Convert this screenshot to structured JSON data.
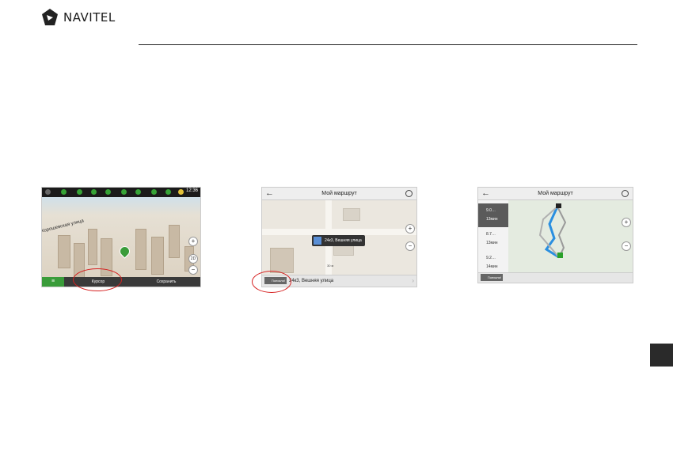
{
  "brand": {
    "name": "NAVITEL"
  },
  "screen1": {
    "time": "12:36",
    "street": "Хорошевская улица",
    "zoom_in": "+",
    "zoom_out": "−",
    "mode": "2D",
    "bottom": [
      "Курсор",
      "Сохранить"
    ]
  },
  "screen2": {
    "title": "Мой маршрут",
    "tooltip": "24к3, Вешняя улица",
    "go_label": "Поехали!",
    "address": "24к3, Вешняя улица",
    "scale": "30 м",
    "zoom_in": "+",
    "zoom_out": "−"
  },
  "screen3": {
    "title": "Мой маршрут",
    "routes": [
      {
        "distance": "9.0…",
        "time": "13мин"
      },
      {
        "distance": "8.7…",
        "time": "13мин"
      },
      {
        "distance": "9.2…",
        "time": "14мин"
      }
    ],
    "go_label": "Поехали!",
    "zoom_in": "+",
    "zoom_out": "−"
  },
  "icons": [
    "navitel-logo-icon",
    "back-arrow-icon",
    "settings-icon",
    "menu-icon",
    "finish-flag-icon"
  ],
  "colors": {
    "accent_green": "#3a9c3a",
    "highlight_red": "#d62020",
    "route_blue": "#2a8fe0"
  }
}
